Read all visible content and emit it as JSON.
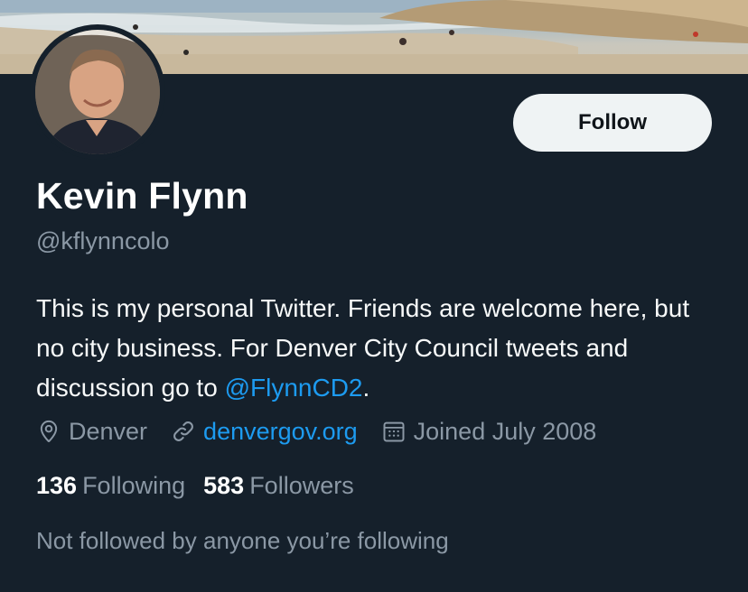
{
  "profile": {
    "name": "Kevin Flynn",
    "handle": "@kflynncolo",
    "bio_text": "This is my personal Twitter. Friends are welcome here, but no city business. For Denver City Council tweets and discussion go to ",
    "bio_mention": "@FlynnCD2",
    "bio_end": ".",
    "location": "Denver",
    "website": "denvergov.org",
    "joined": "Joined July 2008",
    "following_count": "136",
    "following_label": "Following",
    "followers_count": "583",
    "followers_label": "Followers",
    "not_followed": "Not followed by anyone you’re following"
  },
  "actions": {
    "follow_label": "Follow"
  },
  "icons": {
    "location": "location-pin-icon",
    "link": "link-icon",
    "calendar": "calendar-icon"
  },
  "colors": {
    "background": "#15202b",
    "accent": "#1d9bf0",
    "muted": "#8b98a5",
    "button_bg": "#eff3f4"
  }
}
